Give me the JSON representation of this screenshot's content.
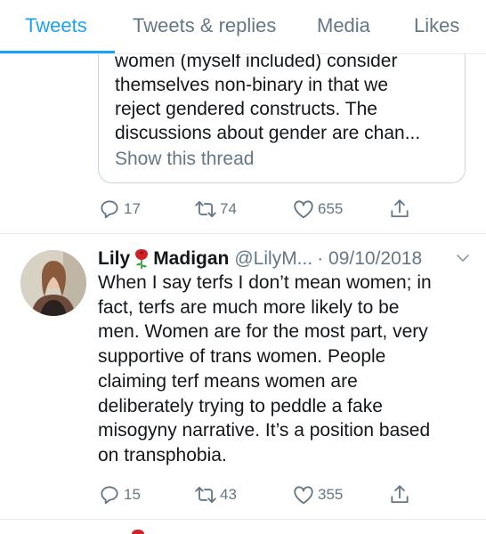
{
  "tabs": [
    {
      "label": "Tweets",
      "active": true
    },
    {
      "label": "Tweets & replies",
      "active": false
    },
    {
      "label": "Media",
      "active": false
    },
    {
      "label": "Likes",
      "active": false
    }
  ],
  "quoted": {
    "lines": [
      "women (myself included) consider",
      "themselves non-binary in that we",
      "reject gendered constructs. The",
      "discussions about gender are chan..."
    ],
    "show_thread": "Show this thread"
  },
  "actions_top": {
    "replies": "17",
    "retweets": "74",
    "likes": "655"
  },
  "tweet": {
    "name_first": "Lily",
    "name_last": "Madigan",
    "handle": "@LilyM...",
    "date": "· 09/10/2018",
    "lines": [
      "When I say terfs I don’t mean women; in",
      "fact, terfs are much more likely to be",
      "men. Women are for the most part, very",
      "supportive of trans women. People",
      "claiming terf means women are",
      "deliberately trying to peddle a fake",
      "misogyny narrative. It’s a position based",
      "on transphobia."
    ]
  },
  "actions_bottom": {
    "replies": "15",
    "retweets": "43",
    "likes": "355"
  },
  "icons": [
    "reply-icon",
    "retweet-icon",
    "like-icon",
    "share-icon",
    "chevron-down-icon",
    "rose-emoji-icon"
  ],
  "colors": {
    "accent": "#1da1f2",
    "muted": "#657786",
    "text": "#14171a",
    "border": "#e6ecf0"
  }
}
